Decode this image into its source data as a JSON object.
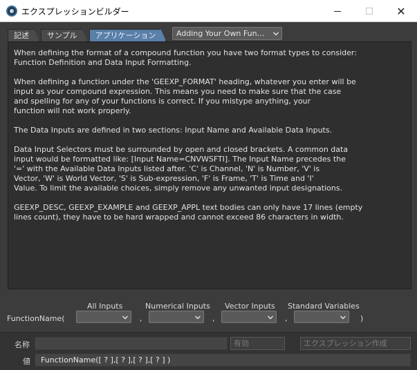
{
  "window": {
    "title": "エクスプレッションビルダー",
    "minimize_label": "minimize",
    "maximize_label": "maximize",
    "close_label": "close"
  },
  "tabs": [
    {
      "label": "記述",
      "active": false
    },
    {
      "label": "サンプル",
      "active": false
    },
    {
      "label": "アプリケーション",
      "active": true
    }
  ],
  "topic_select": {
    "value": "Adding Your Own Fun…"
  },
  "help": {
    "paragraphs": [
      "When defining the format of a compound function you have two format types to consider:\nFunction Definition and Data Input Formatting.",
      "When defining a function under the 'GEEXP_FORMAT' heading, whatever you enter will be\ninput as your compound expression. This means you need to make sure that the case\nand spelling for any of your functions is correct. If you mistype anything, your\nfunction will not work properly.",
      "The Data Inputs are defined in two sections: Input Name and Available Data Inputs.",
      "Data Input Selectors must be surrounded by open and closed brackets. A common data\ninput would be formatted like: [Input Name=CNVWSFTI]. The Input Name precedes the\n'=' with the Available Data Inputs listed after. 'C' is Channel, 'N' is Number, 'V' is\nVector, 'W' is World Vector, 'S' is Sub-expression, 'F' is Frame, 'T' is Time and 'I'\nValue. To limit the available choices, simply remove any unwanted input designations.",
      "GEEXP_DESC, GEEXP_EXAMPLE and GEEXP_APPL text bodies can only have 17 lines (empty\nlines count), they have to be hard wrapped and cannot exceed 86 characters in width."
    ]
  },
  "builder": {
    "function_label": "FunctionName(",
    "close_paren": ")",
    "comma": ",",
    "columns": [
      "All Inputs",
      "Numerical Inputs",
      "Vector Inputs",
      "Standard Variables"
    ]
  },
  "bottom": {
    "name_label": "名称",
    "name_value": "",
    "valid_button": "有効",
    "create_button": "エクスプレッション作成",
    "value_label": "値",
    "value_text": "FunctionName([ ? ],[ ? ],[ ? ],[ ? ] )"
  },
  "colors": {
    "accent_tab": "#5a7fa8",
    "background": "#3c3c3c",
    "panel": "#2f2f2f"
  }
}
